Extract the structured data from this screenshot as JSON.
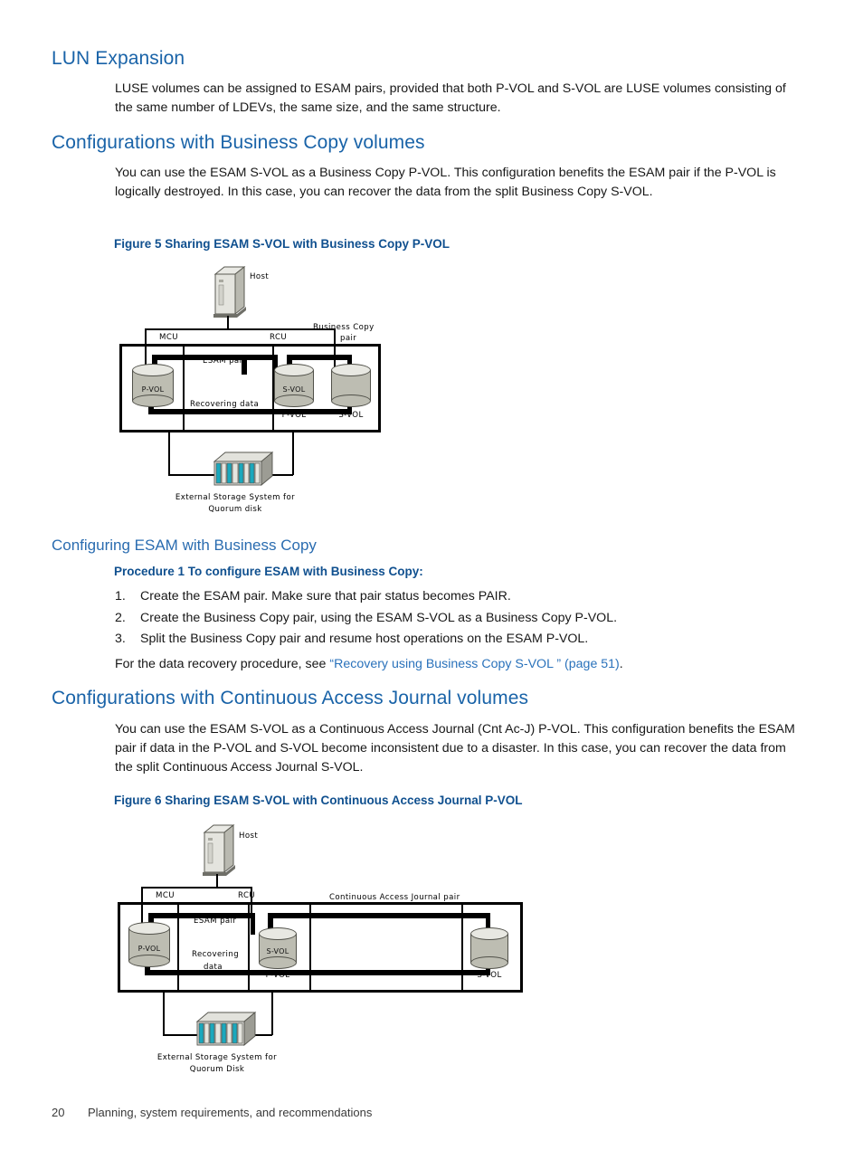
{
  "page": {
    "footer_page_number": "20",
    "footer_text": "Planning, system requirements, and recommendations"
  },
  "sections": {
    "lun_expansion": {
      "heading": "LUN Expansion",
      "paragraph": "LUSE volumes can be assigned to ESAM pairs, provided that both P-VOL and S-VOL are LUSE volumes consisting of the same number of LDEVs, the same size, and the same structure."
    },
    "business_copy": {
      "heading": "Configurations with Business Copy volumes",
      "paragraph": "You can use the ESAM S-VOL as a Business Copy P-VOL. This configuration benefits the ESAM pair if the P-VOL is logically destroyed. In this case, you can recover the data from the split Business Copy S-VOL.",
      "figure_caption": "Figure 5 Sharing ESAM S-VOL with Business Copy P-VOL"
    },
    "configuring": {
      "heading": "Configuring ESAM with Business Copy",
      "procedure_title": "Procedure 1 To configure ESAM with Business Copy:",
      "steps": [
        {
          "marker": "1.",
          "text": "Create the ESAM pair. Make sure that pair status becomes PAIR."
        },
        {
          "marker": "2.",
          "text": "Create the Business Copy pair, using the ESAM S-VOL as a Business Copy P-VOL."
        },
        {
          "marker": "3.",
          "text": "Split the Business Copy pair and resume host operations on the ESAM P-VOL."
        }
      ],
      "closing_prefix": "For the data recovery procedure, see ",
      "closing_link": "“Recovery using Business Copy S-VOL ” (page 51)",
      "closing_suffix": "."
    },
    "cnt_ac_j": {
      "heading": "Configurations with Continuous Access Journal volumes",
      "paragraph": "You can use the ESAM S-VOL as a Continuous Access Journal (Cnt Ac-J) P-VOL. This configuration benefits the ESAM pair if data in the P-VOL and S-VOL become inconsistent due to a disaster. In this case, you can recover the data from the split Continuous Access Journal S-VOL.",
      "figure_caption": "Figure 6 Sharing ESAM S-VOL with Continuous Access Journal P-VOL"
    }
  },
  "figure5": {
    "host_label": "Host",
    "mcu_label": "MCU",
    "rcu_label": "RCU",
    "bc_pair_label_line1": "Business Copy",
    "bc_pair_label_line2": "pair",
    "esam_pair_label": "ESAM pair",
    "recovering_label": "Recovering data",
    "vol_pvol": "P-VOL",
    "vol_svol_mid": "S-VOL",
    "vol_svol_mid_sub": "P-VOL",
    "vol_svol_right": "S-VOL",
    "storage_label_line1": "External Storage System for",
    "storage_label_line2": "Quorum disk"
  },
  "figure6": {
    "host_label": "Host",
    "mcu_label": "MCU",
    "rcu_label": "RCU",
    "cnt_pair_label": "Continuous Access Journal pair",
    "esam_pair_label": "ESAM pair",
    "recovering_label_line1": "Recovering",
    "recovering_label_line2": "data",
    "vol_pvol": "P-VOL",
    "vol_svol_mid": "S-VOL",
    "vol_svol_mid_sub": "P-VOL",
    "vol_svol_right": "S-VOL",
    "storage_label_line1": "External Storage System for",
    "storage_label_line2": "Quorum Disk"
  },
  "colors": {
    "heading_blue": "#1963a8",
    "subheading_blue": "#2a6cb0",
    "caption_blue": "#10508f",
    "link_blue": "#2a72bb",
    "cylinder_body": "#bdbdb2",
    "cylinder_top": "#e8e8e2",
    "storage_accent": "#1aa8bd"
  }
}
